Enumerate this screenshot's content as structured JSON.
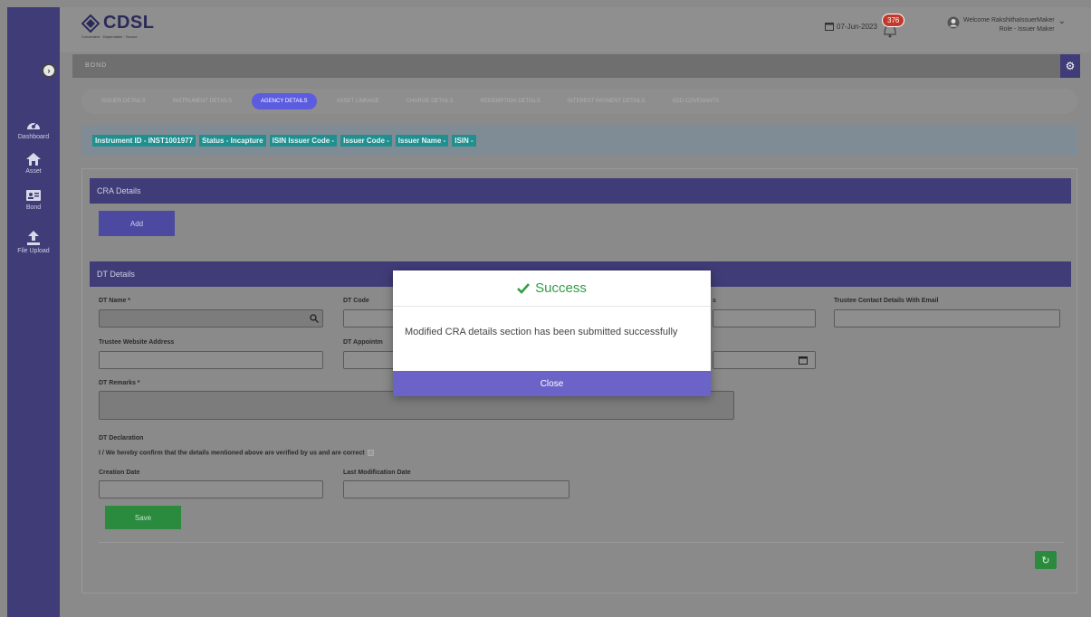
{
  "header": {
    "logo_text": "CDSL",
    "logo_tagline": "Convenient · Dependable · Secure",
    "date": "07-Jun-2023",
    "notification_count": "376",
    "welcome": "Welcome RakshithaIssuerMaker",
    "role": "Role - Issuer Maker"
  },
  "sidebar": {
    "items": [
      {
        "label": "Dashboard",
        "icon": "dashboard-icon"
      },
      {
        "label": "Asset",
        "icon": "home-icon"
      },
      {
        "label": "Bond",
        "icon": "id-card-icon"
      },
      {
        "label": "File Upload",
        "icon": "upload-icon"
      }
    ]
  },
  "breadcrumb": "BOND",
  "tabs": [
    {
      "label": "ISSUER DETAILS",
      "active": false
    },
    {
      "label": "INSTRUMENT DETAILS",
      "active": false
    },
    {
      "label": "AGENCY DETAILS",
      "active": true
    },
    {
      "label": "ASSET LINKAGE",
      "active": false
    },
    {
      "label": "CHARGE DETAILS",
      "active": false
    },
    {
      "label": "REDEMPTION DETAILS",
      "active": false
    },
    {
      "label": "INTEREST PAYMENT DETAILS",
      "active": false
    },
    {
      "label": "ADD COVENANTS",
      "active": false
    }
  ],
  "info": {
    "instrument_id": "Instrument ID - INST1001977",
    "status": "Status - Incapture",
    "isin_issuer_code": "ISIN Issuer Code -",
    "issuer_code": "Issuer Code -",
    "issuer_name": "Issuer Name -",
    "isin": "ISIN -"
  },
  "cra": {
    "title": "CRA Details",
    "add_label": "Add"
  },
  "dt": {
    "title": "DT Details",
    "dt_name_label": "DT Name *",
    "dt_code_label": "DT Code",
    "trustee_contact_suffix": "s",
    "trustee_contact_email_label": "Trustee Contact Details With Email",
    "trustee_website_label": "Trustee Website Address",
    "dt_appointment_label": "DT Appointm",
    "dt_remarks_label": "DT Remarks *",
    "declaration_title": "DT Declaration",
    "declaration_text": "I / We hereby confirm that the details mentioned above are verified by us and are correct",
    "creation_date_label": "Creation Date",
    "last_mod_label": "Last Modification Date",
    "save_label": "Save"
  },
  "modal": {
    "title": "Success",
    "message": "Modified CRA details section has been submitted successfully",
    "close_label": "Close"
  },
  "colors": {
    "sidebar": "#3f3c78",
    "accent": "#5b5ce0",
    "success": "#2e9e44",
    "modal_button": "#6b63c8",
    "save_button": "#2a8a3e"
  }
}
